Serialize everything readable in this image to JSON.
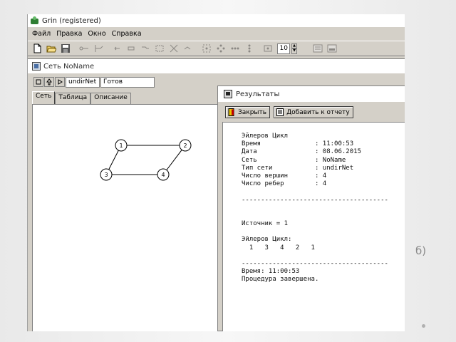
{
  "app": {
    "title": "Grin (registered)"
  },
  "menu": [
    "Файл",
    "Правка",
    "Окно",
    "Справка"
  ],
  "toolbar": {
    "spin_value": "10",
    "icons": [
      "new-file-icon",
      "open-folder-icon",
      "save-icon",
      "edge-tool-icon",
      "arc-tool-icon",
      "undo-icon",
      "redo-icon",
      "connect-icon",
      "grid-icon",
      "layout-icon",
      "link-icon",
      "layout-circle-icon",
      "layout-tree-icon",
      "layout-radial-icon",
      "layout-star-icon",
      "zoom-icon",
      "preview-icon",
      "print-icon"
    ]
  },
  "net_window": {
    "title": "Сеть NoName",
    "net_type": "undirNet",
    "status": "Готов",
    "tabs": [
      "Сеть",
      "Таблица",
      "Описание"
    ],
    "graph": {
      "nodes": [
        {
          "label": "1"
        },
        {
          "label": "2"
        },
        {
          "label": "3"
        },
        {
          "label": "4"
        }
      ],
      "edges": [
        [
          "1",
          "2"
        ],
        [
          "2",
          "4"
        ],
        [
          "4",
          "3"
        ],
        [
          "3",
          "1"
        ]
      ]
    }
  },
  "results": {
    "title": "Результаты",
    "close_label": "Закрыть",
    "add_label": "Добавить к отчету",
    "report_lines": [
      "Эйлеров Цикл",
      "Время              : 11:00:53",
      "Дата               : 08.06.2015",
      "Сеть               : NoName",
      "Тип сети           : undirNet",
      "Число вершин       : 4",
      "Число ребер        : 4",
      "",
      "--------------------------------------",
      "",
      "",
      "Источник = 1",
      "",
      "Эйлеров Цикл:",
      "  1   3   4   2   1",
      "",
      "--------------------------------------",
      "Время: 11:00:53",
      "Процедура завершена."
    ]
  },
  "slide": {
    "side_label": "б)"
  }
}
